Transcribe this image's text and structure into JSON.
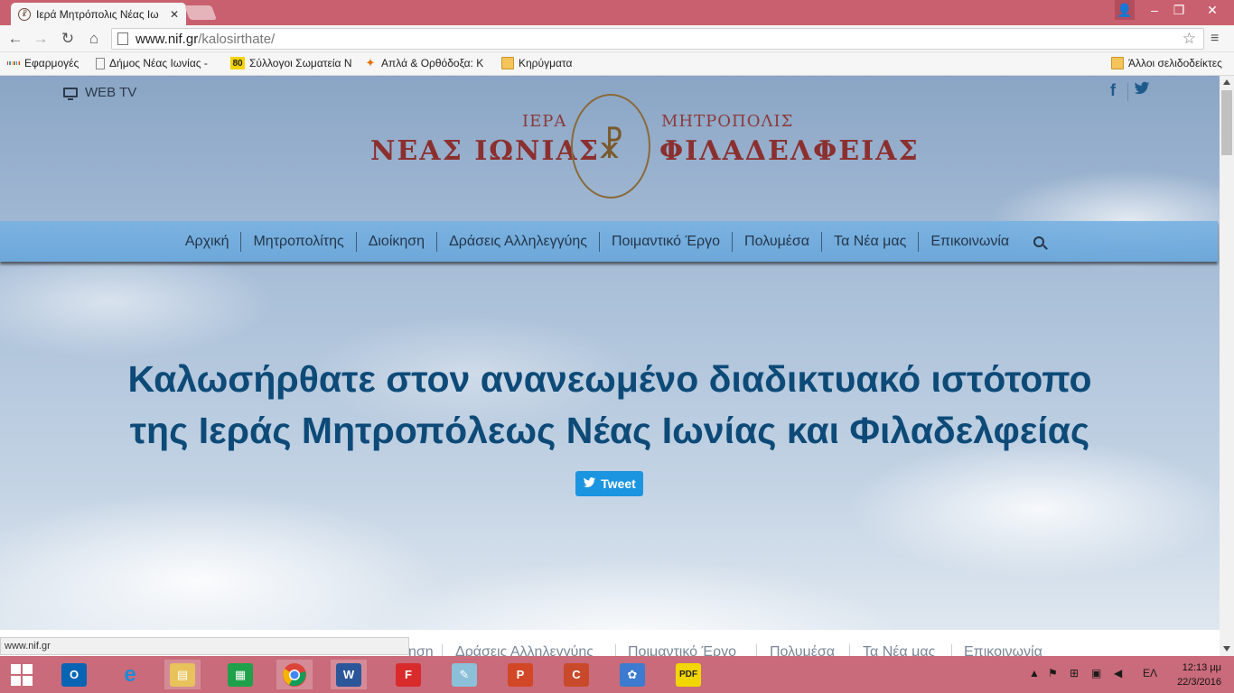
{
  "browser": {
    "tab_title": "Ιερά Μητρόπολις Νέας Ιω",
    "tab_close": "✕",
    "url_host": "www.nif.gr",
    "url_path": "/kalosirthate/",
    "status_url": "www.nif.gr",
    "bookmarks": [
      {
        "label": "Εφαρμογές",
        "icon": "apps-icon"
      },
      {
        "label": "Δήμος Νέας Ιωνίας -",
        "icon": "page-icon"
      },
      {
        "label": "Σύλλογοι Σωματεία Ν",
        "icon": "80-badge-icon",
        "badge": "80"
      },
      {
        "label": "Απλά & Ορθόδοξα: Κ",
        "icon": "site-icon"
      },
      {
        "label": "Κηρύγματα",
        "icon": "folder-icon"
      }
    ],
    "other_bookmarks": "Άλλοι σελιδοδείκτες"
  },
  "site": {
    "webtv_label": "WEB TV",
    "social": {
      "facebook": "f",
      "twitter": "🐦"
    },
    "logo": {
      "ierA": "ΙΕΡΑ",
      "mitropolis": "ΜΗΤΡΟΠΟΛΙΣ",
      "neas_ionias": "ΝΕΑΣ ΙΩΝΙΑΣ",
      "filadelfeias": "ΦΙΛΑΔΕΛΦΕΙΑΣ",
      "seal_glyph": "☧"
    },
    "nav": [
      "Αρχική",
      "Μητροπολίτης",
      "Διοίκηση",
      "Δράσεις Αλληλεγγύης",
      "Ποιμαντικό Έργο",
      "Πολυμέσα",
      "Τα Νέα μας",
      "Επικοινωνία"
    ],
    "headline_line1": "Καλωσήρθατε στον ανανεωμένο διαδικτυακό ιστότοπο",
    "headline_line2": "της Ιεράς Μητροπόλεως Νέας Ιωνίας και Φιλαδελφείας",
    "tweet_label": "Tweet",
    "sticky_nav_partial": [
      "ηση",
      "Δράσεις Αλληλεγγύης",
      "Ποιμαντικό Έργο",
      "Πολυμέσα",
      "Τα Νέα μας",
      "Επικοινωνία"
    ]
  },
  "taskbar": {
    "apps": [
      "start-icon",
      "outlook-icon",
      "internet-explorer-icon",
      "file-explorer-icon",
      "store-icon",
      "chrome-icon",
      "word-icon",
      "foxit-reader-icon",
      "notepad-icon",
      "powerpoint-icon",
      "ccleaner-icon",
      "paint-icon",
      "pdf-icon"
    ],
    "language": "ΕΛ",
    "time": "12:13 μμ",
    "date": "22/3/2016"
  },
  "colors": {
    "titlebar": "#c9606f",
    "taskbar": "#c96b7a",
    "headline": "#0d4a78",
    "logo_red": "#8b2f2f",
    "nav_bg": "#6ba8dc"
  }
}
